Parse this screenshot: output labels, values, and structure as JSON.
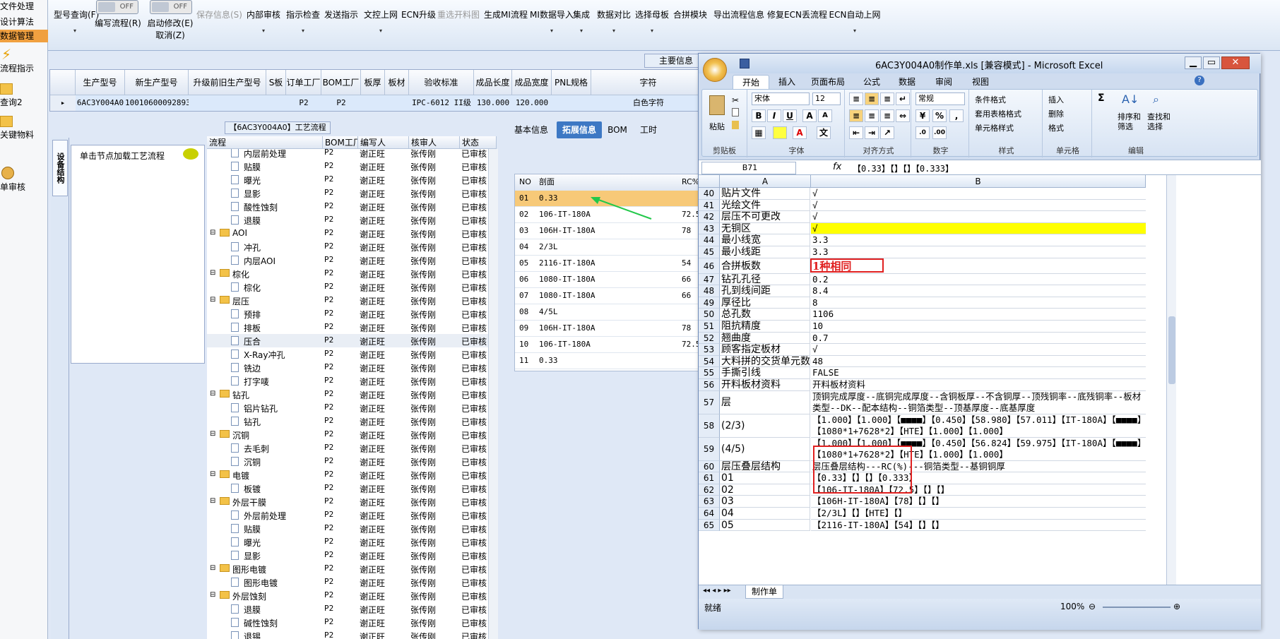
{
  "left_nav": {
    "items": [
      "文件处理",
      "设计算法",
      "数据管理",
      "流程指示",
      "查询2",
      "关键物料",
      "单审核"
    ]
  },
  "toolbar": {
    "items": [
      {
        "label": "型号查询(F)",
        "drop": "▾"
      },
      {
        "label": "编写流程(R)",
        "toggle": "OFF"
      },
      {
        "label": "启动修改(E)",
        "label2": "取消(Z)",
        "toggle": "OFF"
      },
      {
        "label": "保存信息(S)",
        "disabled": true
      },
      {
        "label": "内部审核",
        "drop": "▾"
      },
      {
        "label": "指示检查",
        "drop": "▾"
      },
      {
        "label": "发送指示"
      },
      {
        "label": "文控上网",
        "drop": "▾"
      },
      {
        "label": "ECN升级"
      },
      {
        "label": "重选开料图",
        "disabled": true
      },
      {
        "label": "生成MI流程"
      },
      {
        "label": "MI数据导入",
        "drop": "▾"
      },
      {
        "label": "集成",
        "drop": "▾"
      },
      {
        "label": "数据对比",
        "drop": "▾"
      },
      {
        "label": "选择母板",
        "drop": "▾"
      },
      {
        "label": "合拼模块"
      },
      {
        "label": "导出流程信息"
      },
      {
        "label": "修复ECN丢流程"
      },
      {
        "label": "ECN自动上网",
        "drop": "▾"
      }
    ]
  },
  "main_info": {
    "tab": "主要信息",
    "columns": [
      "生产型号",
      "新生产型号",
      "升级前旧生产型号",
      "S板",
      "订单工厂",
      "BOM工厂",
      "板厚",
      "板材",
      "验收标准",
      "成品长度",
      "成品宽度",
      "PNL规格",
      "字符"
    ],
    "row": [
      "6AC3Y004A0",
      "10010600092893",
      "",
      "",
      "P2",
      "P2",
      "",
      "",
      "IPC-6012 II级",
      "130.000",
      "120.000",
      "",
      "白色字符"
    ]
  },
  "process": {
    "title": "【6AC3Y004A0】工艺流程",
    "side_tab": "设备结构",
    "node_hint": "单击节点加载工艺流程",
    "columns": [
      "流程",
      "BOM工厂",
      "编写人",
      "核审人",
      "状态"
    ],
    "rows": [
      {
        "name": "内层前处理",
        "kind": "doc",
        "level": 2,
        "f": "P2",
        "w": "谢正旺",
        "r": "张传刚",
        "s": "已审核"
      },
      {
        "name": "贴膜",
        "kind": "doc",
        "level": 2,
        "f": "P2",
        "w": "谢正旺",
        "r": "张传刚",
        "s": "已审核"
      },
      {
        "name": "曝光",
        "kind": "doc",
        "level": 2,
        "f": "P2",
        "w": "谢正旺",
        "r": "张传刚",
        "s": "已审核"
      },
      {
        "name": "显影",
        "kind": "doc",
        "level": 2,
        "f": "P2",
        "w": "谢正旺",
        "r": "张传刚",
        "s": "已审核"
      },
      {
        "name": "酸性蚀刻",
        "kind": "doc",
        "level": 2,
        "f": "P2",
        "w": "谢正旺",
        "r": "张传刚",
        "s": "已审核"
      },
      {
        "name": "退膜",
        "kind": "doc",
        "level": 2,
        "f": "P2",
        "w": "谢正旺",
        "r": "张传刚",
        "s": "已审核"
      },
      {
        "name": "AOI",
        "kind": "folder",
        "level": 1,
        "f": "P2",
        "w": "谢正旺",
        "r": "张传刚",
        "s": "已审核"
      },
      {
        "name": "冲孔",
        "kind": "doc",
        "level": 2,
        "f": "P2",
        "w": "谢正旺",
        "r": "张传刚",
        "s": "已审核"
      },
      {
        "name": "内层AOI",
        "kind": "doc",
        "level": 2,
        "f": "P2",
        "w": "谢正旺",
        "r": "张传刚",
        "s": "已审核"
      },
      {
        "name": "棕化",
        "kind": "folder",
        "level": 1,
        "f": "P2",
        "w": "谢正旺",
        "r": "张传刚",
        "s": "已审核"
      },
      {
        "name": "棕化",
        "kind": "doc",
        "level": 2,
        "f": "P2",
        "w": "谢正旺",
        "r": "张传刚",
        "s": "已审核"
      },
      {
        "name": "层压",
        "kind": "folder",
        "level": 1,
        "f": "P2",
        "w": "谢正旺",
        "r": "张传刚",
        "s": "已审核"
      },
      {
        "name": "预排",
        "kind": "doc",
        "level": 2,
        "f": "P2",
        "w": "谢正旺",
        "r": "张传刚",
        "s": "已审核"
      },
      {
        "name": "排板",
        "kind": "doc",
        "level": 2,
        "f": "P2",
        "w": "谢正旺",
        "r": "张传刚",
        "s": "已审核"
      },
      {
        "name": "压合",
        "kind": "doc",
        "level": 2,
        "f": "P2",
        "w": "谢正旺",
        "r": "张传刚",
        "s": "已审核",
        "sel": true
      },
      {
        "name": "X-Ray冲孔",
        "kind": "doc",
        "level": 2,
        "f": "P2",
        "w": "谢正旺",
        "r": "张传刚",
        "s": "已审核"
      },
      {
        "name": "铣边",
        "kind": "doc",
        "level": 2,
        "f": "P2",
        "w": "谢正旺",
        "r": "张传刚",
        "s": "已审核"
      },
      {
        "name": "打字唛",
        "kind": "doc",
        "level": 2,
        "f": "P2",
        "w": "谢正旺",
        "r": "张传刚",
        "s": "已审核"
      },
      {
        "name": "钻孔",
        "kind": "folder",
        "level": 1,
        "f": "P2",
        "w": "谢正旺",
        "r": "张传刚",
        "s": "已审核"
      },
      {
        "name": "铝片钻孔",
        "kind": "doc",
        "level": 2,
        "f": "P2",
        "w": "谢正旺",
        "r": "张传刚",
        "s": "已审核"
      },
      {
        "name": "钻孔",
        "kind": "doc",
        "level": 2,
        "f": "P2",
        "w": "谢正旺",
        "r": "张传刚",
        "s": "已审核"
      },
      {
        "name": "沉铜",
        "kind": "folder",
        "level": 1,
        "f": "P2",
        "w": "谢正旺",
        "r": "张传刚",
        "s": "已审核"
      },
      {
        "name": "去毛刺",
        "kind": "doc",
        "level": 2,
        "f": "P2",
        "w": "谢正旺",
        "r": "张传刚",
        "s": "已审核"
      },
      {
        "name": "沉铜",
        "kind": "doc",
        "level": 2,
        "f": "P2",
        "w": "谢正旺",
        "r": "张传刚",
        "s": "已审核"
      },
      {
        "name": "电镀",
        "kind": "folder",
        "level": 1,
        "f": "P2",
        "w": "谢正旺",
        "r": "张传刚",
        "s": "已审核"
      },
      {
        "name": "板镀",
        "kind": "doc",
        "level": 2,
        "f": "P2",
        "w": "谢正旺",
        "r": "张传刚",
        "s": "已审核"
      },
      {
        "name": "外层干膜",
        "kind": "folder",
        "level": 1,
        "f": "P2",
        "w": "谢正旺",
        "r": "张传刚",
        "s": "已审核"
      },
      {
        "name": "外层前处理",
        "kind": "doc",
        "level": 2,
        "f": "P2",
        "w": "谢正旺",
        "r": "张传刚",
        "s": "已审核"
      },
      {
        "name": "贴膜",
        "kind": "doc",
        "level": 2,
        "f": "P2",
        "w": "谢正旺",
        "r": "张传刚",
        "s": "已审核"
      },
      {
        "name": "曝光",
        "kind": "doc",
        "level": 2,
        "f": "P2",
        "w": "谢正旺",
        "r": "张传刚",
        "s": "已审核"
      },
      {
        "name": "显影",
        "kind": "doc",
        "level": 2,
        "f": "P2",
        "w": "谢正旺",
        "r": "张传刚",
        "s": "已审核"
      },
      {
        "name": "图形电镀",
        "kind": "folder",
        "level": 1,
        "f": "P2",
        "w": "谢正旺",
        "r": "张传刚",
        "s": "已审核"
      },
      {
        "name": "图形电镀",
        "kind": "doc",
        "level": 2,
        "f": "P2",
        "w": "谢正旺",
        "r": "张传刚",
        "s": "已审核"
      },
      {
        "name": "外层蚀刻",
        "kind": "folder",
        "level": 1,
        "f": "P2",
        "w": "谢正旺",
        "r": "张传刚",
        "s": "已审核"
      },
      {
        "name": "退膜",
        "kind": "doc",
        "level": 2,
        "f": "P2",
        "w": "谢正旺",
        "r": "张传刚",
        "s": "已审核"
      },
      {
        "name": "碱性蚀刻",
        "kind": "doc",
        "level": 2,
        "f": "P2",
        "w": "谢正旺",
        "r": "张传刚",
        "s": "已审核"
      },
      {
        "name": "退锡",
        "kind": "doc",
        "level": 2,
        "f": "P2",
        "w": "谢正旺",
        "r": "张传刚",
        "s": "已审核"
      }
    ]
  },
  "center": {
    "tabs": [
      "基本信息",
      "拓展信息",
      "BOM",
      "工时"
    ],
    "active_tab": "拓展信息",
    "stack_columns": [
      "NO",
      "剖面",
      "RC%"
    ],
    "stack_rows": [
      {
        "no": "01",
        "name": "0.33",
        "rc": ""
      },
      {
        "no": "02",
        "name": "106-IT-180A",
        "rc": "72.5"
      },
      {
        "no": "03",
        "name": "106H-IT-180A",
        "rc": "78"
      },
      {
        "no": "04",
        "name": "2/3L",
        "rc": ""
      },
      {
        "no": "05",
        "name": "2116-IT-180A",
        "rc": "54"
      },
      {
        "no": "06",
        "name": "1080-IT-180A",
        "rc": "66"
      },
      {
        "no": "07",
        "name": "1080-IT-180A",
        "rc": "66"
      },
      {
        "no": "08",
        "name": "4/5L",
        "rc": ""
      },
      {
        "no": "09",
        "name": "106H-IT-180A",
        "rc": "78"
      },
      {
        "no": "10",
        "name": "106-IT-180A",
        "rc": "72.5"
      },
      {
        "no": "11",
        "name": "0.33",
        "rc": ""
      }
    ]
  },
  "excel": {
    "title": "6AC3Y004A0制作单.xls  [兼容模式] - Microsoft Excel",
    "ribbon_tabs": [
      "开始",
      "插入",
      "页面布局",
      "公式",
      "数据",
      "审阅",
      "视图"
    ],
    "font_name": "宋体",
    "font_size": "12",
    "number_format": "常规",
    "group_labels": [
      "剪贴板",
      "字体",
      "对齐方式",
      "数字",
      "样式",
      "单元格",
      "编辑"
    ],
    "buttons": {
      "paste": "粘贴",
      "cond_format": "条件格式",
      "table_format": "套用表格格式",
      "cell_style": "单元格样式",
      "insert": "插入",
      "delete": "删除",
      "format": "格式",
      "sort": "排序和筛选",
      "find": "查找和选择"
    },
    "name_box": "B71",
    "formula": "【0.33】【】【】【0.333】",
    "col_a": "A",
    "col_b": "B",
    "rows": [
      {
        "n": "40",
        "a": "贴片文件",
        "b": "√"
      },
      {
        "n": "41",
        "a": "光绘文件",
        "b": "√"
      },
      {
        "n": "42",
        "a": "层压不可更改",
        "b": "√"
      },
      {
        "n": "43",
        "a": "无铜区",
        "b": "√",
        "hl": true
      },
      {
        "n": "44",
        "a": "最小线宽",
        "b": "3.3"
      },
      {
        "n": "45",
        "a": "最小线距",
        "b": "3.3"
      },
      {
        "n": "46",
        "a": "合拼板数",
        "b": "1种相同",
        "red": true
      },
      {
        "n": "47",
        "a": "钻孔孔径",
        "b": "0.2"
      },
      {
        "n": "48",
        "a": "孔到线间距",
        "b": "8.4"
      },
      {
        "n": "49",
        "a": "厚径比",
        "b": "8"
      },
      {
        "n": "50",
        "a": "总孔数",
        "b": "1106"
      },
      {
        "n": "51",
        "a": "阻抗精度",
        "b": "10"
      },
      {
        "n": "52",
        "a": "翘曲度",
        "b": "0.7"
      },
      {
        "n": "53",
        "a": "顾客指定板材",
        "b": "√"
      },
      {
        "n": "54",
        "a": "大料拼的交货单元数",
        "b": "48"
      },
      {
        "n": "55",
        "a": "手撕引线",
        "b": "FALSE"
      },
      {
        "n": "56",
        "a": "开料板材资料",
        "b": "开料板材资料"
      },
      {
        "n": "57",
        "a": "层",
        "b": "顶铜完成厚度--底铜完成厚度--含铜板厚--不含铜厚--顶残铜率--底残铜率--板材类型--DK--配本结构--铜箔类型--顶基厚度--底基厚度",
        "tall": true
      },
      {
        "n": "58",
        "a": "(2/3)",
        "b": "【1.000】【1.000】【■■■■】【0.450】【58.980】【57.011】【IT-180A】【■■■■】【1080*1+7628*2】【HTE】【1.000】【1.000】",
        "tall": true
      },
      {
        "n": "59",
        "a": "(4/5)",
        "b": "【1.000】【1.000】【■■■■】【0.450】【56.824】【59.975】【IT-180A】【■■■■】【1080*1+7628*2】【HTE】【1.000】【1.000】",
        "tall": true
      },
      {
        "n": "60",
        "a": "层压叠层结构",
        "b": "层压叠层结构---RC(%)---铜箔类型--基铜铜厚"
      },
      {
        "n": "61",
        "a": "01",
        "b": "【0.33】【】【】【0.333】"
      },
      {
        "n": "62",
        "a": "02",
        "b": "【106-IT-180A】【72.5】【】【】"
      },
      {
        "n": "63",
        "a": "03",
        "b": "【106H-IT-180A】【78】【】【】"
      },
      {
        "n": "64",
        "a": "04",
        "b": "【2/3L】【】【HTE】【】"
      },
      {
        "n": "65",
        "a": "05",
        "b": "【2116-IT-180A】【54】【】【】"
      }
    ],
    "sheet_tab": "制作单",
    "status": "就绪",
    "zoom": "100%"
  },
  "colors": {
    "accent": "#f0a040",
    "highlight": "#ffff00",
    "red": "#e02020"
  }
}
